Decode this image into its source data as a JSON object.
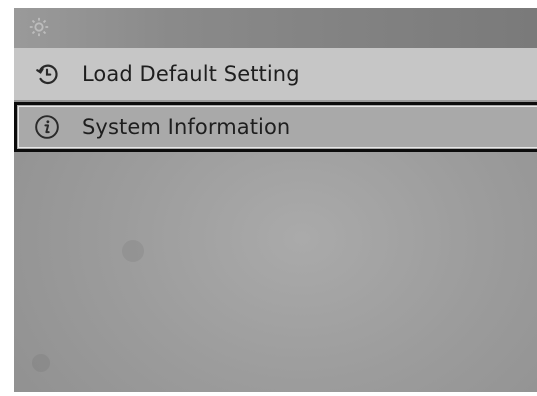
{
  "header": {
    "icon": "gear-icon"
  },
  "menu": {
    "items": [
      {
        "label": "Load Default Setting",
        "icon": "restore-icon",
        "selected": false
      },
      {
        "label": "System Information",
        "icon": "info-icon",
        "selected": true
      }
    ]
  },
  "colors": {
    "header_bg": "#8a8a8a",
    "item_bg": "#c6c6c6",
    "selected_bg": "#a9a9a9",
    "selection_border": "#0c0c0c",
    "text": "#1e1e1e"
  }
}
